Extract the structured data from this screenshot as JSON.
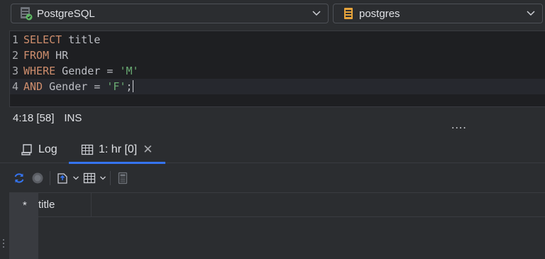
{
  "datasource": {
    "label": "PostgreSQL",
    "icon": "database-icon"
  },
  "schema": {
    "label": "postgres",
    "icon": "schema-icon"
  },
  "editor": {
    "lines": [
      {
        "num": "1",
        "kw": "SELECT",
        "rest": " title"
      },
      {
        "num": "2",
        "kw": "FROM",
        "rest": " HR"
      },
      {
        "num": "3",
        "kw": "WHERE",
        "rest": " Gender = ",
        "str": "'M'"
      },
      {
        "num": "4",
        "kw": "AND",
        "rest": " Gender = ",
        "str": "'F'",
        "tail": ";"
      }
    ]
  },
  "status": {
    "position": "4:18 [58]",
    "mode": "INS",
    "more": "...."
  },
  "tabs": [
    {
      "label": "Log",
      "icon": "log-icon"
    },
    {
      "label": "1: hr [0]",
      "icon": "table-icon",
      "close": "✕"
    }
  ],
  "grid": {
    "row_header": "*",
    "columns": [
      "title"
    ]
  },
  "colors": {
    "keyword": "#cf8e6d",
    "string": "#6aab73",
    "accent": "#3574f0",
    "editor_bg": "#1e1f22",
    "panel_bg": "#2b2d30"
  }
}
